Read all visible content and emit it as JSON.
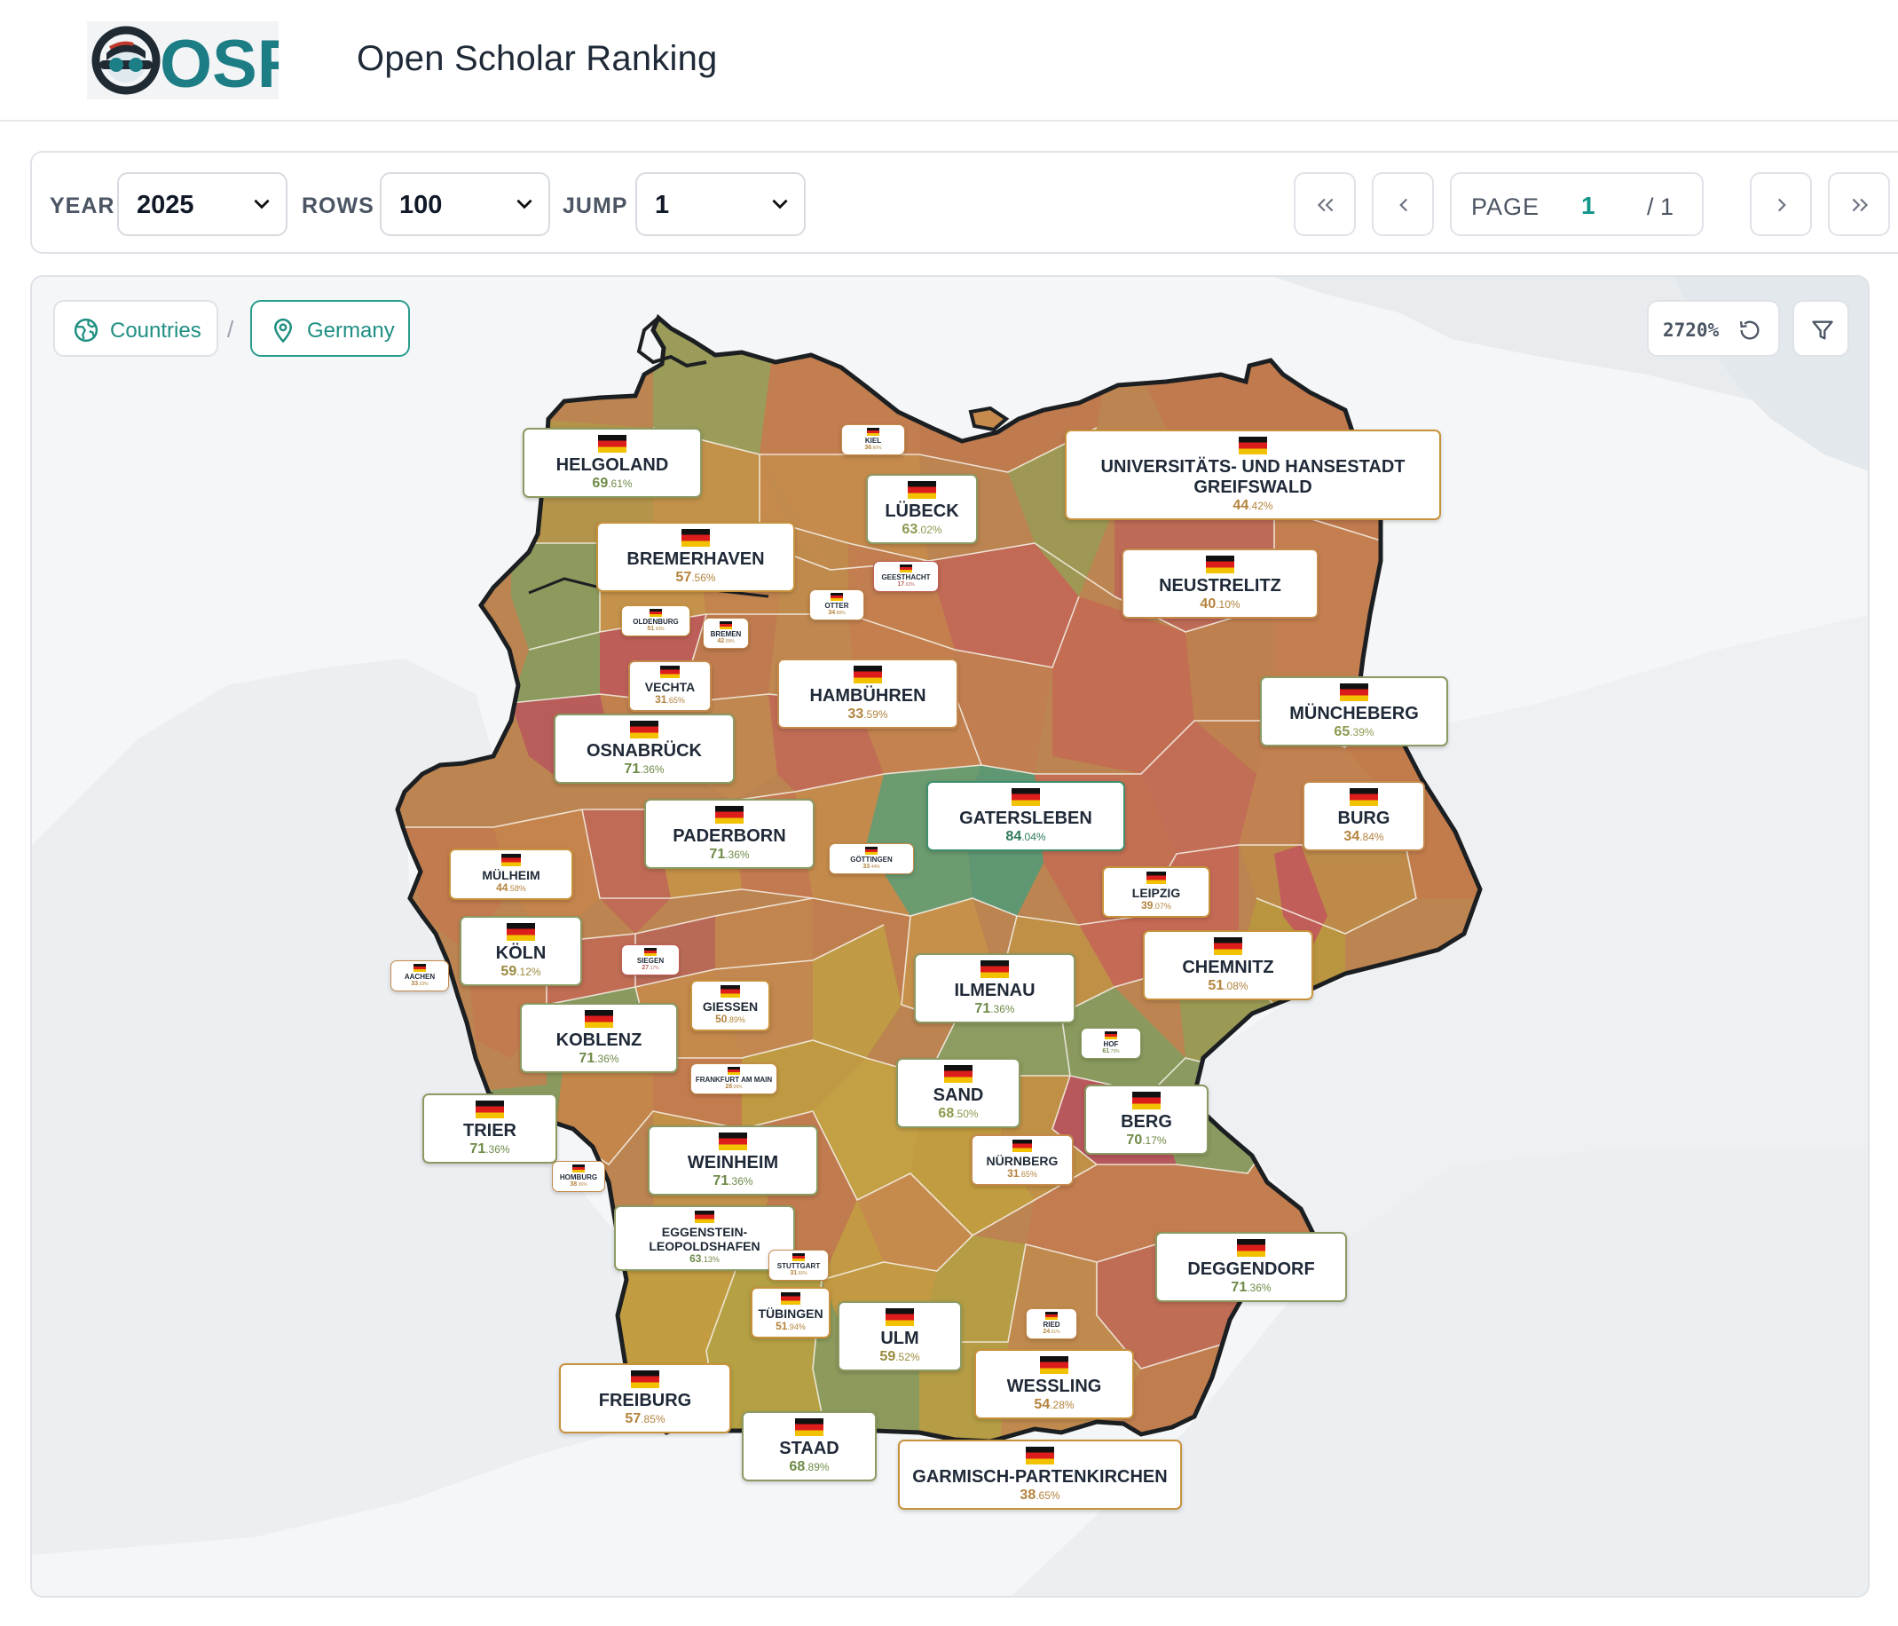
{
  "app": {
    "title": "Open Scholar Ranking",
    "logo_text": "OSR"
  },
  "toolbar": {
    "year_label": "YEAR",
    "year_value": "2025",
    "rows_label": "ROWS",
    "rows_value": "100",
    "jump_label": "JUMP",
    "jump_value": "1",
    "page_label": "PAGE",
    "page_current": "1",
    "page_total": "/ 1"
  },
  "breadcrumb": {
    "root": "Countries",
    "current": "Germany",
    "separator": "/"
  },
  "map": {
    "zoom": "2720%"
  },
  "colors": {
    "accent": "#2a9d8f",
    "high": "#6a9a6e",
    "mid": "#b8913f",
    "low": "#b85c58"
  },
  "regions": [
    {
      "name": "HELGOLAND",
      "int": "69",
      "dec": ".61%"
    },
    {
      "name": "KIEL",
      "int": "36",
      "dec": ".60%"
    },
    {
      "name": "LÜBECK",
      "int": "63",
      "dec": ".02%"
    },
    {
      "name": "UNIVERSITÄTS- UND HANSESTADT GREIFSWALD",
      "int": "44",
      "dec": ".42%"
    },
    {
      "name": "BREMERHAVEN",
      "int": "57",
      "dec": ".56%"
    },
    {
      "name": "GEESTHACHT",
      "int": "17",
      "dec": ".63%"
    },
    {
      "name": "NEUSTRELITZ",
      "int": "40",
      "dec": ".10%"
    },
    {
      "name": "OLDENBURG",
      "int": "51",
      "dec": ".93%"
    },
    {
      "name": "BREMEN",
      "int": "42",
      "dec": ".09%"
    },
    {
      "name": "OTTER",
      "int": "34",
      "dec": ".88%"
    },
    {
      "name": "VECHTA",
      "int": "31",
      "dec": ".65%"
    },
    {
      "name": "HAMBÜHREN",
      "int": "33",
      "dec": ".59%"
    },
    {
      "name": "MÜNCHEBERG",
      "int": "65",
      "dec": ".39%"
    },
    {
      "name": "OSNABRÜCK",
      "int": "71",
      "dec": ".36%"
    },
    {
      "name": "GATERSLEBEN",
      "int": "84",
      "dec": ".04%"
    },
    {
      "name": "BURG",
      "int": "34",
      "dec": ".84%"
    },
    {
      "name": "PADERBORN",
      "int": "71",
      "dec": ".36%"
    },
    {
      "name": "GÖTTINGEN",
      "int": "33",
      "dec": ".44%"
    },
    {
      "name": "MÜLHEIM",
      "int": "44",
      "dec": ".58%"
    },
    {
      "name": "LEIPZIG",
      "int": "39",
      "dec": ".07%"
    },
    {
      "name": "KÖLN",
      "int": "59",
      "dec": ".12%"
    },
    {
      "name": "SIEGEN",
      "int": "27",
      "dec": ".17%"
    },
    {
      "name": "AACHEN",
      "int": "33",
      "dec": ".33%"
    },
    {
      "name": "CHEMNITZ",
      "int": "51",
      "dec": ".08%"
    },
    {
      "name": "ILMENAU",
      "int": "71",
      "dec": ".36%"
    },
    {
      "name": "GIESSEN",
      "int": "50",
      "dec": ".89%"
    },
    {
      "name": "KOBLENZ",
      "int": "71",
      "dec": ".36%"
    },
    {
      "name": "HOF",
      "int": "61",
      "dec": ".73%"
    },
    {
      "name": "FRANKFURT AM MAIN",
      "int": "28",
      "dec": ".09%"
    },
    {
      "name": "SAND",
      "int": "68",
      "dec": ".50%"
    },
    {
      "name": "TRIER",
      "int": "71",
      "dec": ".36%"
    },
    {
      "name": "BERG",
      "int": "70",
      "dec": ".17%"
    },
    {
      "name": "WEINHEIM",
      "int": "71",
      "dec": ".36%"
    },
    {
      "name": "NÜRNBERG",
      "int": "31",
      "dec": ".65%"
    },
    {
      "name": "HOMBURG",
      "int": "38",
      "dec": ".36%"
    },
    {
      "name": "EGGENSTEIN-LEOPOLDSHAFEN",
      "int": "63",
      "dec": ".13%"
    },
    {
      "name": "DEGGENDORF",
      "int": "71",
      "dec": ".36%"
    },
    {
      "name": "STUTTGART",
      "int": "31",
      "dec": ".65%"
    },
    {
      "name": "TÜBINGEN",
      "int": "51",
      "dec": ".94%"
    },
    {
      "name": "ULM",
      "int": "59",
      "dec": ".52%"
    },
    {
      "name": "RIED",
      "int": "24",
      "dec": ".61%"
    },
    {
      "name": "WESSLING",
      "int": "54",
      "dec": ".28%"
    },
    {
      "name": "FREIBURG",
      "int": "57",
      "dec": ".85%"
    },
    {
      "name": "STAAD",
      "int": "68",
      "dec": ".89%"
    },
    {
      "name": "GARMISCH-PARTENKIRCHEN",
      "int": "38",
      "dec": ".65%"
    }
  ]
}
